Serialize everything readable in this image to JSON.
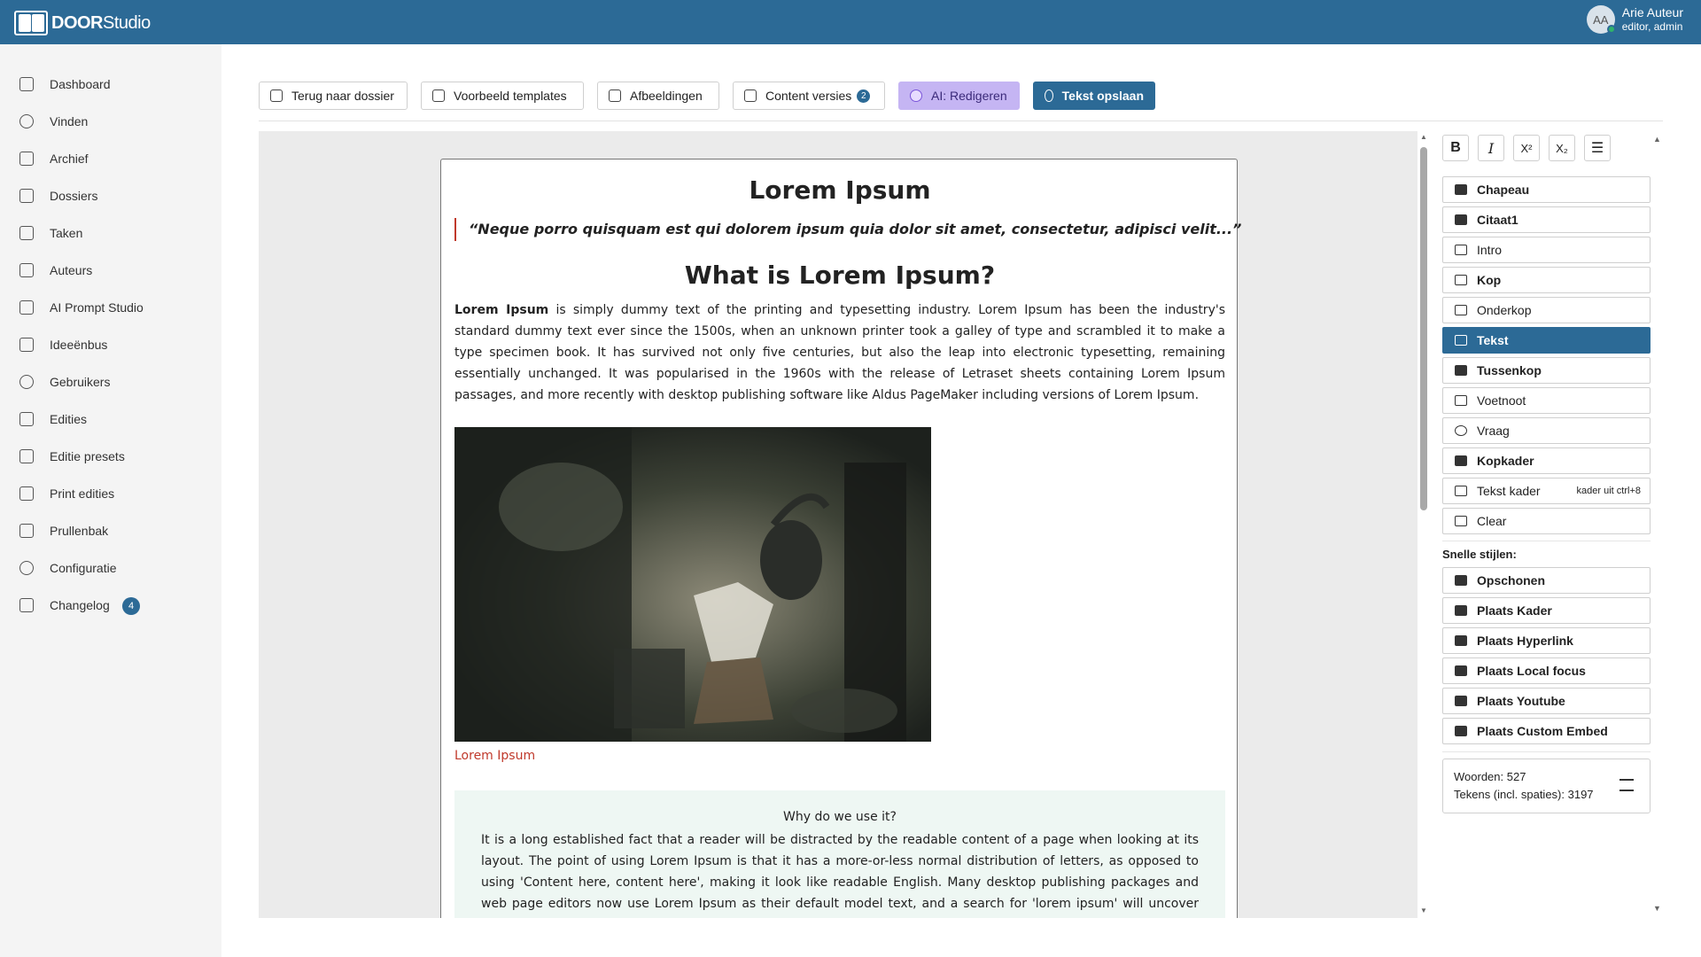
{
  "header": {
    "logo_bold": "DOOR",
    "logo_light": "Studio",
    "user_initials": "AA",
    "user_name": "Arie Auteur",
    "user_role": "editor, admin"
  },
  "sidebar": {
    "items": [
      {
        "label": "Dashboard",
        "icon": "dashboard-icon"
      },
      {
        "label": "Vinden",
        "icon": "search-icon"
      },
      {
        "label": "Archief",
        "icon": "archive-icon"
      },
      {
        "label": "Dossiers",
        "icon": "dossier-icon"
      },
      {
        "label": "Taken",
        "icon": "tasks-icon"
      },
      {
        "label": "Auteurs",
        "icon": "pen-icon"
      },
      {
        "label": "AI Prompt Studio",
        "icon": "ai-icon"
      },
      {
        "label": "Ideeënbus",
        "icon": "idea-icon"
      },
      {
        "label": "Gebruikers",
        "icon": "users-icon"
      },
      {
        "label": "Edities",
        "icon": "editions-icon"
      },
      {
        "label": "Editie presets",
        "icon": "presets-icon"
      },
      {
        "label": "Print edities",
        "icon": "print-icon"
      },
      {
        "label": "Prullenbak",
        "icon": "trash-icon"
      },
      {
        "label": "Configuratie",
        "icon": "gear-icon"
      },
      {
        "label": "Changelog",
        "icon": "rss-icon",
        "badge": "4"
      }
    ]
  },
  "toolbar": {
    "back_label": "Terug naar dossier",
    "templates_label": "Voorbeeld templates",
    "images_label": "Afbeeldingen",
    "versions_label": "Content versies",
    "versions_count": "2",
    "ai_label": "AI: Redigeren",
    "save_label": "Tekst opslaan",
    "colors": {
      "primary": "#2c6a96",
      "ai": "#c5b5f3"
    }
  },
  "document": {
    "title": "Lorem Ipsum",
    "quote": "“Neque porro quisquam est qui dolorem ipsum quia dolor sit amet, consectetur, adipisci velit...”",
    "heading": "What is Lorem Ipsum?",
    "para_bold": "Lorem Ipsum",
    "para_rest": " is simply dummy text of the printing and typesetting industry. Lorem Ipsum has been the industry's standard dummy text ever since the 1500s, when an unknown printer took a galley of type and scrambled it to make a type specimen book. It has survived not only five centuries, but also the leap into electronic typesetting, remaining essentially unchanged. It was popularised in the 1960s with the release of Letraset sheets containing Lorem Ipsum passages, and more recently with desktop publishing software like Aldus PageMaker including versions of Lorem Ipsum.",
    "image_caption": "Lorem Ipsum",
    "box_title": "Why do we use it?",
    "box_text": "It is a long established fact that a reader will be distracted by the readable content of a page when looking at its layout. The point of using Lorem Ipsum is that it has a more-or-less normal distribution of letters, as opposed to using 'Content here, content here', making it look like readable English. Many desktop publishing packages and web page editors now use Lorem Ipsum as their default model text, and a search for 'lorem ipsum' will uncover many web sites still in their"
  },
  "panel": {
    "format_buttons": [
      {
        "label": "B",
        "icon": "bold-icon"
      },
      {
        "label": "I",
        "icon": "italic-icon"
      },
      {
        "label": "X²",
        "icon": "superscript-icon"
      },
      {
        "label": "X₂",
        "icon": "subscript-icon"
      },
      {
        "label": "☰",
        "icon": "list-icon"
      }
    ],
    "styles": [
      {
        "label": "Chapeau",
        "icon": "chapeau-icon"
      },
      {
        "label": "Citaat1",
        "icon": "quote-icon"
      },
      {
        "label": "Intro",
        "icon": "intro-icon"
      },
      {
        "label": "Kop",
        "icon": "heading-icon"
      },
      {
        "label": "Onderkop",
        "icon": "subheading-icon"
      },
      {
        "label": "Tekst",
        "icon": "text-icon",
        "active": true
      },
      {
        "label": "Tussenkop",
        "icon": "interheading-icon"
      },
      {
        "label": "Voetnoot",
        "icon": "footnote-icon"
      },
      {
        "label": "Vraag",
        "icon": "question-icon"
      },
      {
        "label": "Kopkader",
        "icon": "headbox-icon"
      },
      {
        "label": "Tekst kader",
        "icon": "textbox-icon",
        "hint": "kader uit ctrl+8"
      },
      {
        "label": "Clear",
        "icon": "clear-icon"
      }
    ],
    "quick_styles_label": "Snelle stijlen:",
    "quick_styles": [
      {
        "label": "Opschonen",
        "icon": "clean-icon"
      },
      {
        "label": "Plaats Kader",
        "icon": "place-box-icon"
      },
      {
        "label": "Plaats Hyperlink",
        "icon": "hyperlink-icon"
      },
      {
        "label": "Plaats Local focus",
        "icon": "local-focus-icon"
      },
      {
        "label": "Plaats Youtube",
        "icon": "youtube-icon"
      },
      {
        "label": "Plaats Custom Embed",
        "icon": "embed-icon"
      }
    ],
    "stats": {
      "words": "Woorden: 527",
      "chars": "Tekens (incl. spaties): 3197"
    }
  }
}
